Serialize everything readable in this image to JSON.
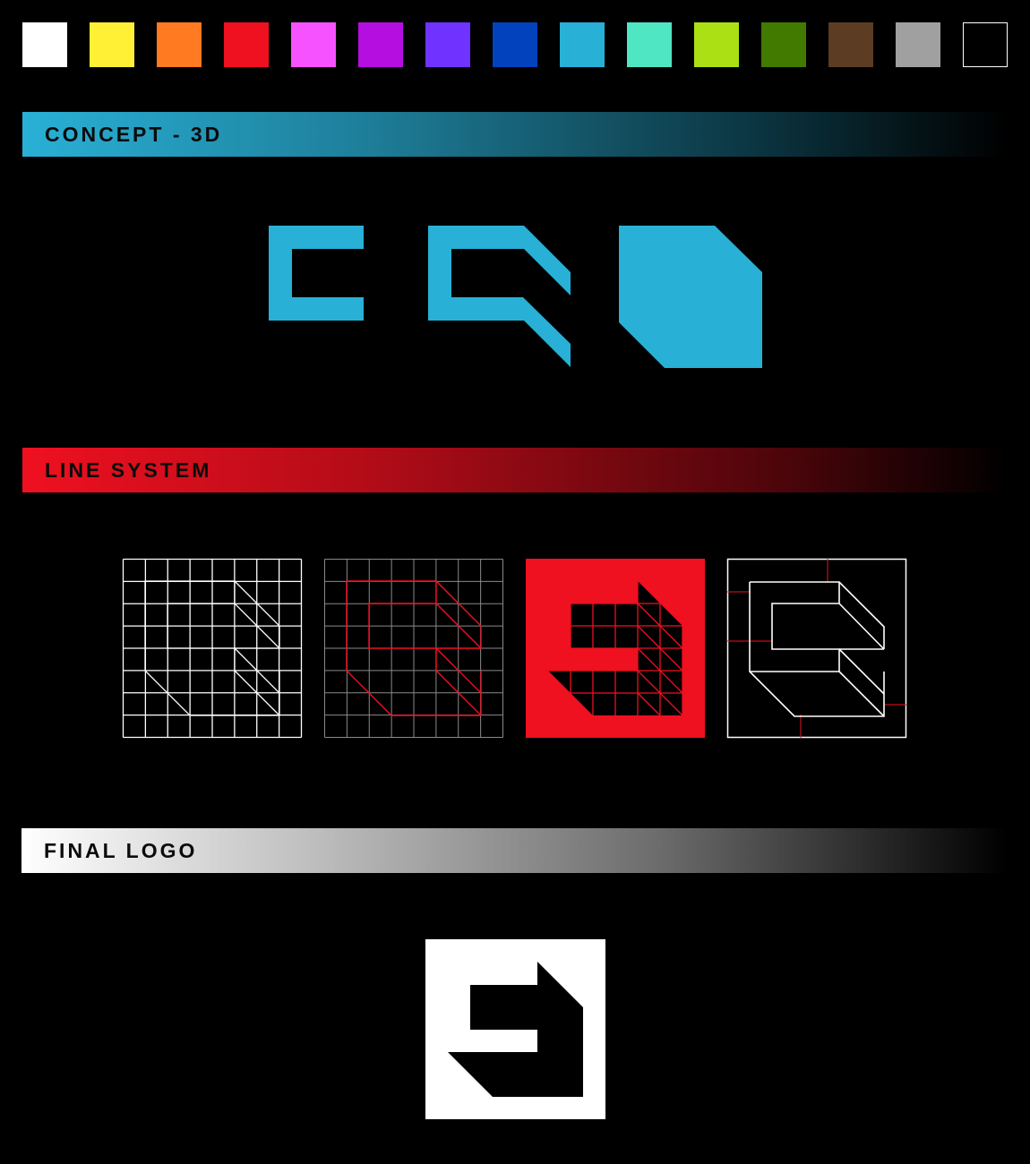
{
  "palette": {
    "swatches": [
      {
        "name": "white",
        "color": "#ffffff"
      },
      {
        "name": "yellow",
        "color": "#fff035"
      },
      {
        "name": "orange",
        "color": "#ff7a20"
      },
      {
        "name": "red",
        "color": "#ef1020"
      },
      {
        "name": "pink",
        "color": "#f652ff"
      },
      {
        "name": "purple",
        "color": "#b50ee0"
      },
      {
        "name": "violet",
        "color": "#7033ff"
      },
      {
        "name": "blue",
        "color": "#0242bd"
      },
      {
        "name": "cyan",
        "color": "#29b0d6"
      },
      {
        "name": "mint",
        "color": "#4fe6c4"
      },
      {
        "name": "lime",
        "color": "#abe015"
      },
      {
        "name": "green",
        "color": "#427a00"
      },
      {
        "name": "brown",
        "color": "#5c3d24"
      },
      {
        "name": "gray",
        "color": "#a0a0a0"
      },
      {
        "name": "black",
        "color": "#000000"
      }
    ]
  },
  "sections": {
    "concept": {
      "title": "CONCEPT - 3D",
      "color": "#29b0d6"
    },
    "line": {
      "title": "LINE SYSTEM",
      "color": "#ef1020"
    },
    "final": {
      "title": "FINAL LOGO",
      "color": "#ffffff"
    }
  },
  "colors": {
    "background": "#000000",
    "grid_white": "#ffffff",
    "grid_red": "#ef1020",
    "logo_white": "#ffffff"
  }
}
